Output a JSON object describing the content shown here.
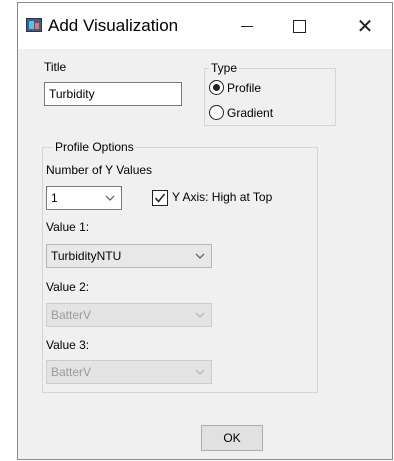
{
  "window": {
    "title": "Add Visualization",
    "minimize_glyph": "—",
    "maximize_glyph": "☐",
    "close_glyph": "✕"
  },
  "title_field": {
    "label": "Title",
    "value": "Turbidity"
  },
  "type_group": {
    "legend": "Type",
    "options": [
      {
        "label": "Profile",
        "checked": true
      },
      {
        "label": "Gradient",
        "checked": false
      }
    ]
  },
  "profile_options": {
    "legend": "Profile Options",
    "num_y_label": "Number of Y Values",
    "num_y_value": "1",
    "y_axis_high_top_label": "Y Axis: High at Top",
    "y_axis_high_top_checked": true,
    "value1_label": "Value 1:",
    "value1": "TurbidityNTU",
    "value2_label": "Value 2:",
    "value2": "BatterV",
    "value3_label": "Value 3:",
    "value3": "BatterV"
  },
  "ok_label": "OK"
}
